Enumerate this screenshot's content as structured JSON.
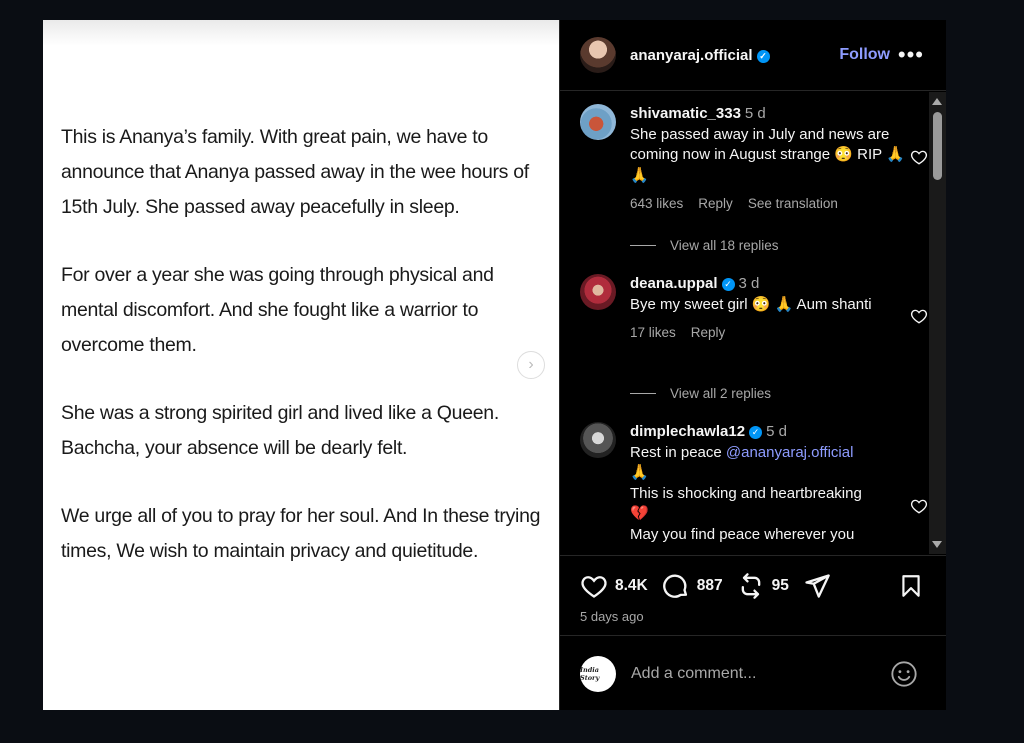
{
  "post": {
    "paragraphs": [
      "This is Ananya’s family. With great pain, we have to announce that Ananya passed away in the wee hours of 15th July. She passed away peacefully in sleep.",
      "For over a year she was going through physical and mental discomfort. And she fought like a warrior to overcome them.",
      "She was a strong spirited girl and lived like a Queen. Bachcha, your absence will be dearly felt.",
      "We urge all of you to pray for her soul. And In these trying times, We wish to maintain privacy and quietitude."
    ]
  },
  "header": {
    "username": "ananyaraj.official",
    "follow_label": "Follow",
    "more_label": "•••"
  },
  "comments": [
    {
      "username": "shivamatic_333",
      "time": "5 d",
      "text": "She passed away in July and news are coming now in August strange 😳 RIP 🙏 🙏",
      "likes": "643 likes",
      "reply": "Reply",
      "translate": "See translation",
      "view_replies": "View all 18 replies"
    },
    {
      "username": "deana.uppal",
      "time": "3 d",
      "text": "Bye my sweet girl 😳 🙏 Aum shanti",
      "likes": "17 likes",
      "reply": "Reply",
      "view_replies": "View all 2 replies"
    },
    {
      "username": "dimplechawla12",
      "time": "5 d",
      "text_prefix": "Rest in peace ",
      "mention": "@ananyaraj.official",
      "line2": "🙏",
      "line3": "This is shocking and heartbreaking",
      "line4": "💔",
      "line5": "May you find peace wherever you"
    }
  ],
  "actions": {
    "likes": "8.4K",
    "comments": "887",
    "reposts": "95",
    "date": "5 days ago"
  },
  "add_comment": {
    "placeholder": "Add a comment...",
    "avatar_text": "India Story"
  },
  "colors": {
    "accent": "#8e9cff",
    "verified": "#0095f6",
    "muted": "#a8a8a8"
  }
}
